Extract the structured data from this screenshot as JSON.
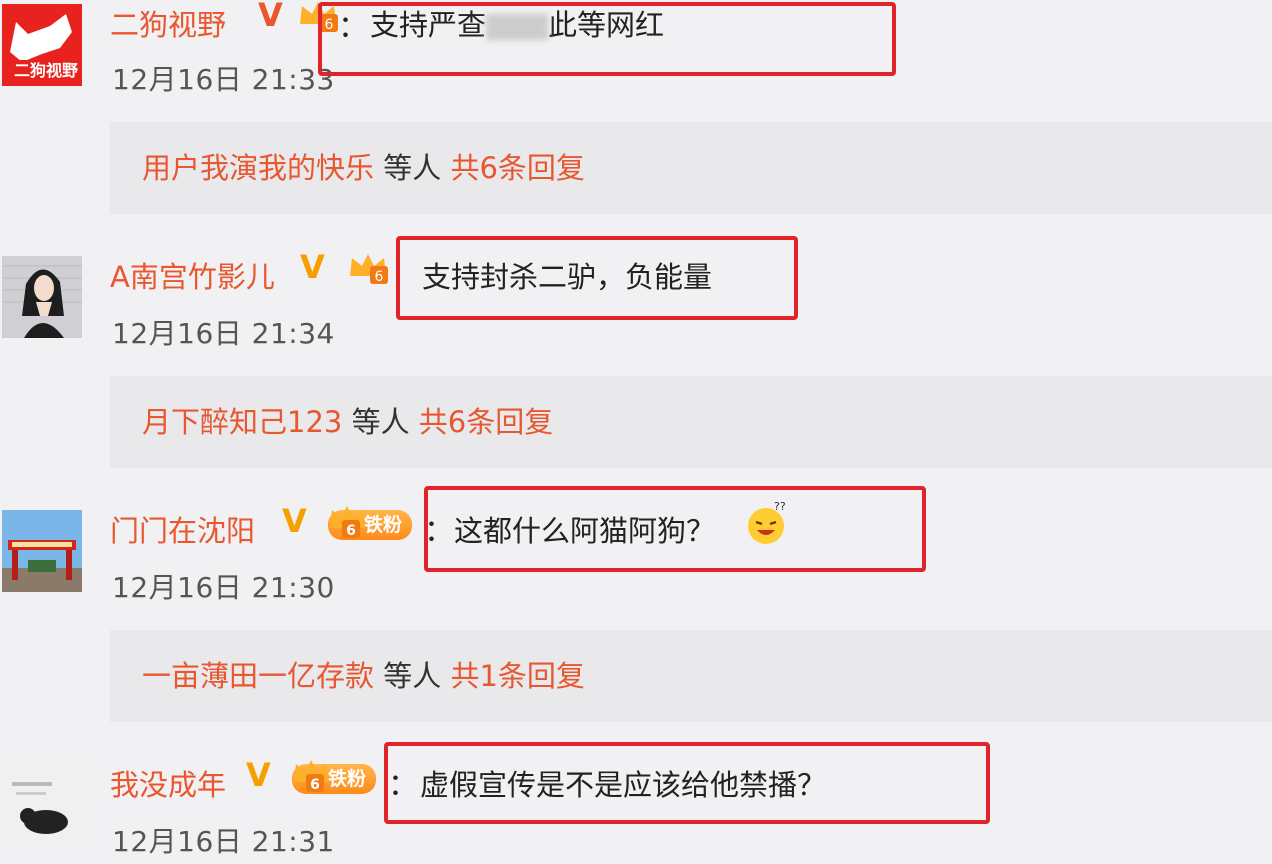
{
  "comments": [
    {
      "username": "二狗视野",
      "fan_level": "6",
      "colon": "：",
      "text_before": "支持严查",
      "text_after": "此等网红",
      "time": "12月16日 21:33",
      "avatar_text": "二狗视野"
    },
    {
      "username": "A南宫竹影儿",
      "fan_level": "6",
      "text": "支持封杀二驴，负能量",
      "time": "12月16日 21:34"
    },
    {
      "username": "门门在沈阳",
      "fan_level": "6",
      "fan_label": "铁粉",
      "colon": "：",
      "text": "这都什么阿猫阿狗？",
      "time": "12月16日 21:30"
    },
    {
      "username": "我没成年",
      "fan_level": "6",
      "fan_label": "铁粉",
      "colon": "：",
      "text": "虚假宣传是不是应该给他禁播？",
      "time": "12月16日 21:31"
    }
  ],
  "replies": [
    {
      "user": "用户我演我的快乐",
      "mid": " 等人 ",
      "count": "共6条回复"
    },
    {
      "user": "月下醉知己123",
      "mid": " 等人 ",
      "count": "共6条回复"
    },
    {
      "user": "一亩薄田一亿存款",
      "mid": " 等人 ",
      "count": "共1条回复"
    }
  ],
  "colors": {
    "accent": "#e8572f",
    "highlight_box": "#e0252a",
    "badge_gold": "#f5a000"
  }
}
